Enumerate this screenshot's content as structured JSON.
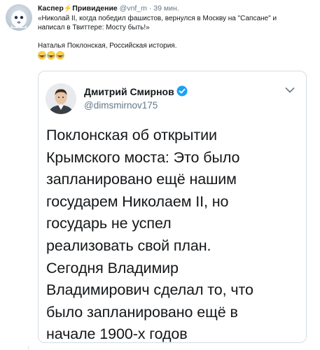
{
  "tweet": {
    "author_name": "Каспер",
    "author_name_suffix": "Привидение",
    "handle": "@vnf_m",
    "separator": "·",
    "time": "39 мин.",
    "text_line_1": "«Николай II, когда победил фашистов, вернулся в Москву на \"Сапсане\" и",
    "text_line_2": "написал в Твиттере: Мосту быть!»",
    "text_line_3": "Наталья Поклонская, Российская история.",
    "emoji": [
      "face-with-tears-of-joy",
      "face-with-tears-of-joy",
      "face-with-tears-of-joy"
    ]
  },
  "quoted_tweet": {
    "author_name": "Дмитрий Смирнов",
    "handle": "@dimsmirnov175",
    "verified": true,
    "lines": [
      "Поклонская об открытии",
      "Крымского моста: Это было",
      "запланировано ещё нашим",
      "государем Николаем II, но",
      "государь не успел",
      "реализовать свой план.",
      "Сегодня Владимир",
      "Владимирович сделал то, что",
      "было запланировано ещё в",
      "начале 1900-х годов"
    ]
  },
  "colors": {
    "text": "#14171a",
    "secondary": "#657786",
    "verified_blue": "#1da1f2",
    "border": "#d3dde5",
    "bolt": "#f5a623"
  }
}
